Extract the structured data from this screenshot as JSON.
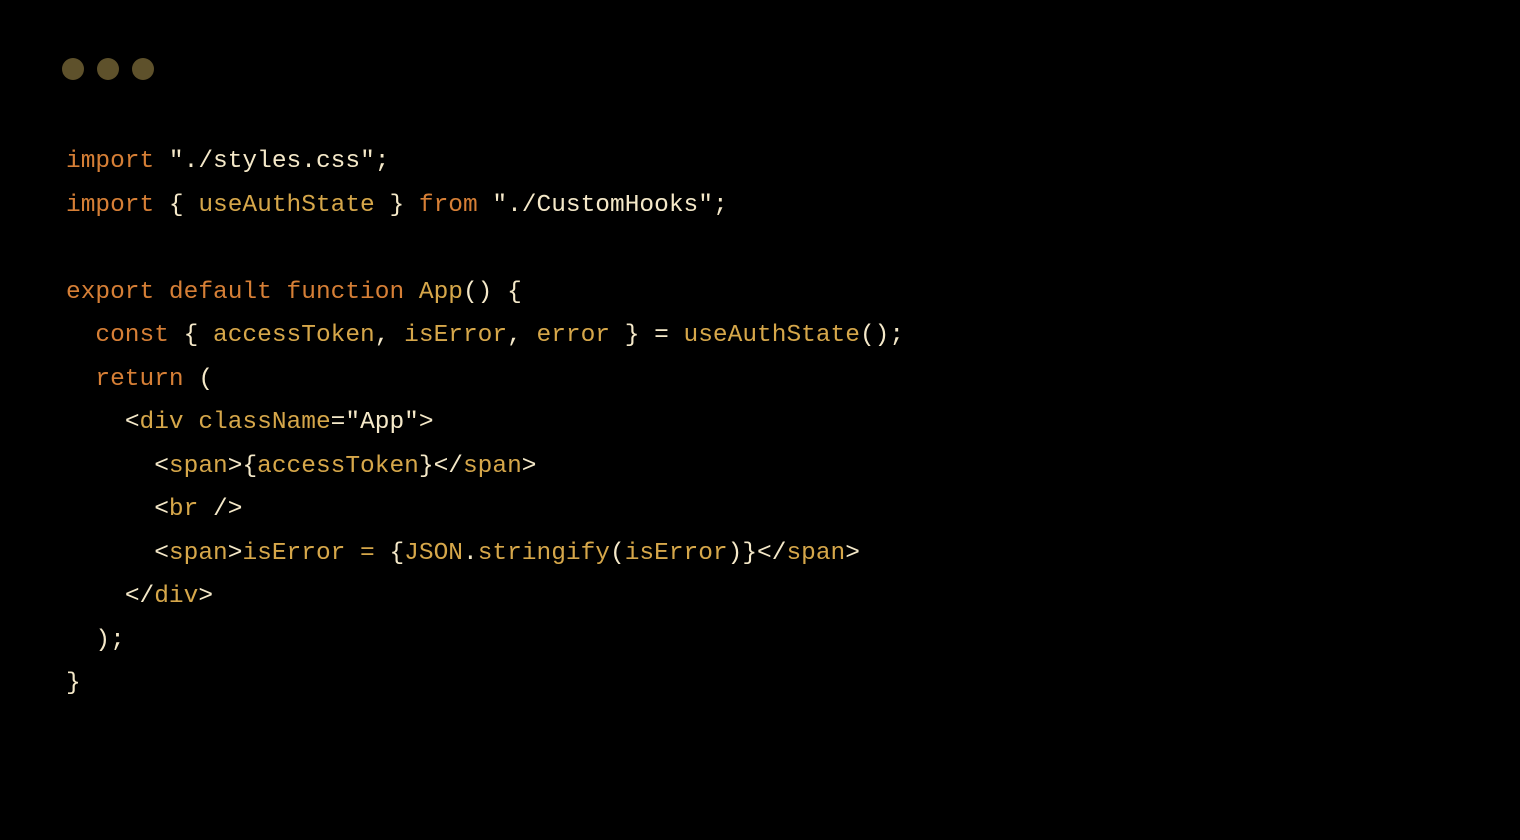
{
  "code": {
    "line1": {
      "kw_import": "import",
      "sp": " ",
      "q1": "\"",
      "str": "./styles.css",
      "q2": "\"",
      "semi": ";"
    },
    "line2": {
      "kw_import": "import",
      "sp1": " ",
      "lb": "{ ",
      "ident": "useAuthState",
      "rb": " }",
      "sp2": " ",
      "kw_from": "from",
      "sp3": " ",
      "q1": "\"",
      "str": "./CustomHooks",
      "q2": "\"",
      "semi": ";"
    },
    "line3": "",
    "line4": {
      "kw_export": "export",
      "sp1": " ",
      "kw_default": "default",
      "sp2": " ",
      "kw_function": "function",
      "sp3": " ",
      "name": "App",
      "parens": "()",
      "sp4": " ",
      "lb": "{"
    },
    "line5": {
      "indent": "  ",
      "kw_const": "const",
      "sp1": " ",
      "lb": "{ ",
      "id1": "accessToken",
      "c1": ", ",
      "id2": "isError",
      "c2": ", ",
      "id3": "error",
      "rb": " }",
      "sp2": " ",
      "eq": "=",
      "sp3": " ",
      "fn": "useAuthState",
      "call": "();"
    },
    "line6": {
      "indent": "  ",
      "kw_return": "return",
      "sp": " ",
      "open": "("
    },
    "line7": {
      "indent": "    ",
      "lt": "<",
      "tag": "div",
      "sp": " ",
      "attr": "className",
      "eq": "=",
      "q1": "\"",
      "val": "App",
      "q2": "\"",
      "gt": ">"
    },
    "line8": {
      "indent": "      ",
      "lt": "<",
      "tag": "span",
      "gt": ">",
      "lbr": "{",
      "expr": "accessToken",
      "rbr": "}",
      "lt2": "</",
      "tag2": "span",
      "gt2": ">"
    },
    "line9": {
      "indent": "      ",
      "lt": "<",
      "tag": "br",
      "sp": " ",
      "slash": "/>"
    },
    "line10": {
      "indent": "      ",
      "lt": "<",
      "tag": "span",
      "gt": ">",
      "txt": "isError = ",
      "lbr": "{",
      "obj": "JSON",
      "dot": ".",
      "m": "stringify",
      "lp": "(",
      "arg": "isError",
      "rp": ")",
      "rbr": "}",
      "lt2": "</",
      "tag2": "span",
      "gt2": ">"
    },
    "line11": {
      "indent": "    ",
      "lt": "</",
      "tag": "div",
      "gt": ">"
    },
    "line12": {
      "indent": "  ",
      "close": ");"
    },
    "line13": {
      "close": "}"
    }
  }
}
